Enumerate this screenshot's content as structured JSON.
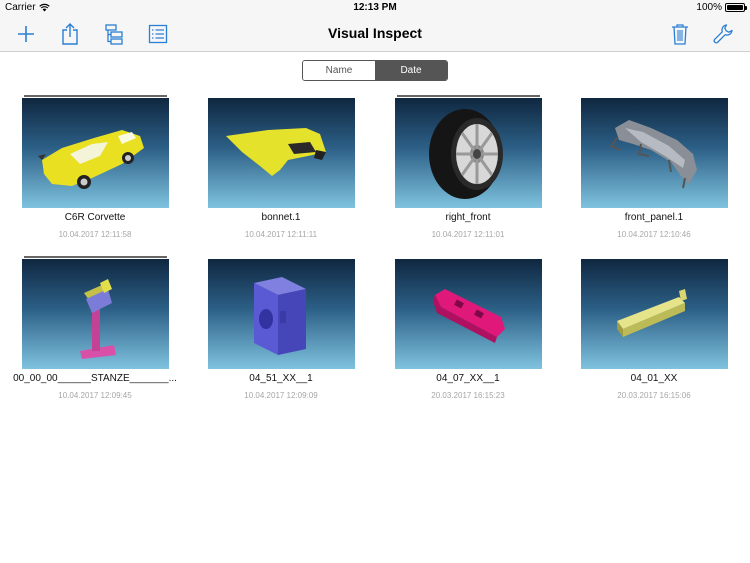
{
  "status": {
    "carrier": "Carrier",
    "time": "12:13 PM",
    "battery": "100%"
  },
  "nav": {
    "title": "Visual Inspect"
  },
  "toolbar": {
    "left_icons": [
      "plus-icon",
      "share-icon",
      "hierarchy-icon",
      "list-icon"
    ],
    "right_icons": [
      "trash-icon",
      "wrench-icon"
    ],
    "accent": "#2a7fd4"
  },
  "sort": {
    "options": [
      "Name",
      "Date"
    ],
    "selected": "Date"
  },
  "files": [
    {
      "name": "C6R Corvette",
      "date": "10.04.2017 12:11:58"
    },
    {
      "name": "bonnet.1",
      "date": "10.04.2017 12:11:11"
    },
    {
      "name": "right_front",
      "date": "10.04.2017 12:11:01"
    },
    {
      "name": "front_panel.1",
      "date": "10.04.2017 12:10:46"
    },
    {
      "name": "00_00_00______STANZE_______...",
      "date": "10.04.2017 12:09:45"
    },
    {
      "name": "04_51_XX__1",
      "date": "10.04.2017 12:09:09"
    },
    {
      "name": "04_07_XX__1",
      "date": "20.03.2017 16:15:23"
    },
    {
      "name": "04_01_XX",
      "date": "20.03.2017 16:15:06"
    }
  ]
}
